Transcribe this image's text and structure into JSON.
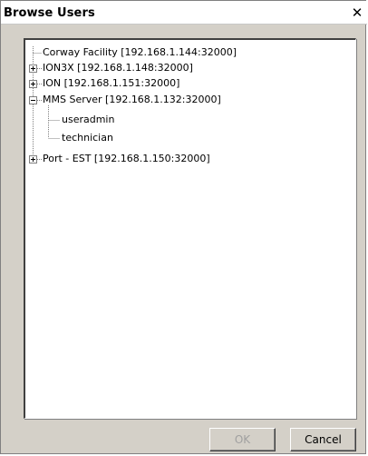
{
  "window": {
    "title": "Browse Users",
    "close_glyph": "✕"
  },
  "tree": {
    "nodes": [
      {
        "label": "Corway Facility  [192.168.1.144:32000]",
        "expander": "none"
      },
      {
        "label": "ION3X  [192.168.1.148:32000]",
        "expander": "plus"
      },
      {
        "label": "ION  [192.168.1.151:32000]",
        "expander": "plus"
      },
      {
        "label": "MMS Server  [192.168.1.132:32000]",
        "expander": "minus"
      },
      {
        "label": "useradmin",
        "expander": "none"
      },
      {
        "label": "technician",
        "expander": "none"
      },
      {
        "label": "Port - EST  [192.168.1.150:32000]",
        "expander": "plus"
      }
    ]
  },
  "buttons": {
    "ok_label": "OK",
    "ok_enabled": false,
    "cancel_label": "Cancel"
  },
  "colors": {
    "dialog_face": "#d4d0c8",
    "tree_background": "#ffffff",
    "disabled_text": "#a0a0a0",
    "tree_line": "#808080"
  }
}
